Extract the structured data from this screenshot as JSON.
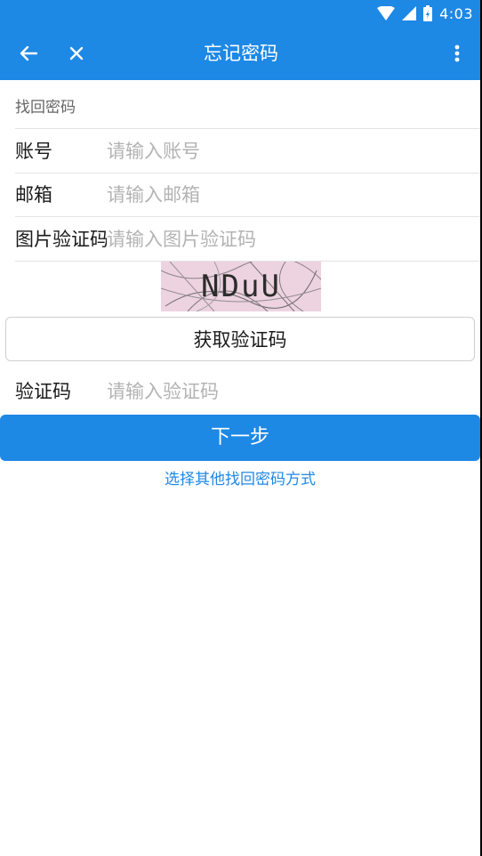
{
  "status_bar": {
    "time": "4:03",
    "icons": [
      "wifi-icon",
      "signal-icon",
      "battery-icon"
    ]
  },
  "app_bar": {
    "title": "忘记密码",
    "icons": [
      "back-arrow-icon",
      "close-icon",
      "more-vert-icon"
    ]
  },
  "form": {
    "section_label": "找回密码",
    "account": {
      "label": "账号",
      "placeholder": "请输入账号"
    },
    "email": {
      "label": "邮箱",
      "placeholder": "请输入邮箱"
    },
    "image_captcha": {
      "label": "图片验证码",
      "placeholder": "请输入图片验证码",
      "captcha_text": "NDuU"
    },
    "get_code_button": "获取验证码",
    "code": {
      "label": "验证码",
      "placeholder": "请输入验证码"
    },
    "next_button": "下一步",
    "other_methods_link": "选择其他找回密码方式"
  },
  "colors": {
    "primary": "#1e88e5",
    "placeholder": "#b3b3b3",
    "divider": "#e3e3e3"
  }
}
